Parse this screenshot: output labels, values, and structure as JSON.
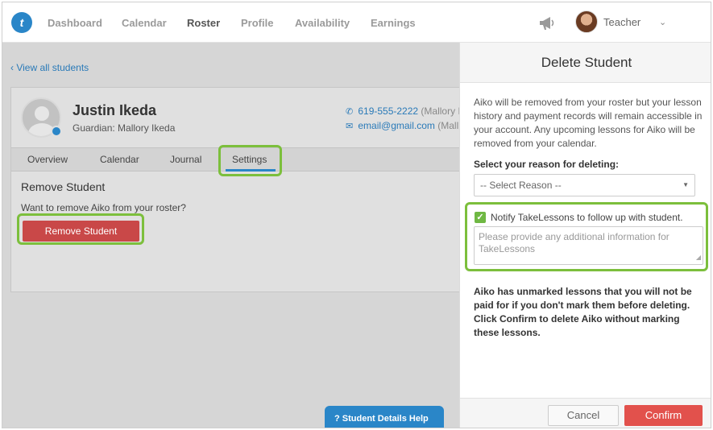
{
  "nav": {
    "logo_text": "t",
    "items": [
      {
        "label": "Dashboard"
      },
      {
        "label": "Calendar"
      },
      {
        "label": "Roster"
      },
      {
        "label": "Profile"
      },
      {
        "label": "Availability"
      },
      {
        "label": "Earnings"
      }
    ],
    "active": "Roster",
    "user_name": "Teacher",
    "icons": {
      "megaphone": "megaphone-icon",
      "dropdown": "chevron-down-icon"
    }
  },
  "roster": {
    "back_link": "‹ View all students",
    "student_name": "Justin Ikeda",
    "guardian": "Guardian: Mallory Ikeda",
    "phone": "619-555-2222",
    "phone_suffix": "(Mallory I",
    "email": "email@gmail.com",
    "email_suffix": "(Mall",
    "tabs": [
      {
        "label": "Overview"
      },
      {
        "label": "Calendar"
      },
      {
        "label": "Journal"
      },
      {
        "label": "Settings"
      }
    ],
    "active_tab": "Settings",
    "remove_title": "Remove Student",
    "remove_desc": "Want to remove Aiko from your roster?",
    "remove_button": "Remove Student",
    "help_tab": "? Student Details Help"
  },
  "delete_panel": {
    "title": "Delete Student",
    "description": "Aiko will be removed from your roster but your lesson history and payment records will remain accessible in your account. Any upcoming lessons for Aiko will be removed from your calendar.",
    "reason_label": "Select your reason for deleting:",
    "reason_select_value": "-- Select Reason --",
    "notify_checked": true,
    "notify_label": "Notify TakeLessons to follow up with student.",
    "info_placeholder": "Please provide any additional information for TakeLessons",
    "warning": "Aiko has unmarked lessons that you will not be paid for if you don't mark them before deleting. Click Confirm to delete Aiko without marking these lessons.",
    "cancel_label": "Cancel",
    "confirm_label": "Confirm"
  },
  "colors": {
    "accent_blue": "#2a86c8",
    "highlight_green": "#7cbf3c",
    "danger_red": "#c94848",
    "confirm_red": "#e2514c"
  }
}
